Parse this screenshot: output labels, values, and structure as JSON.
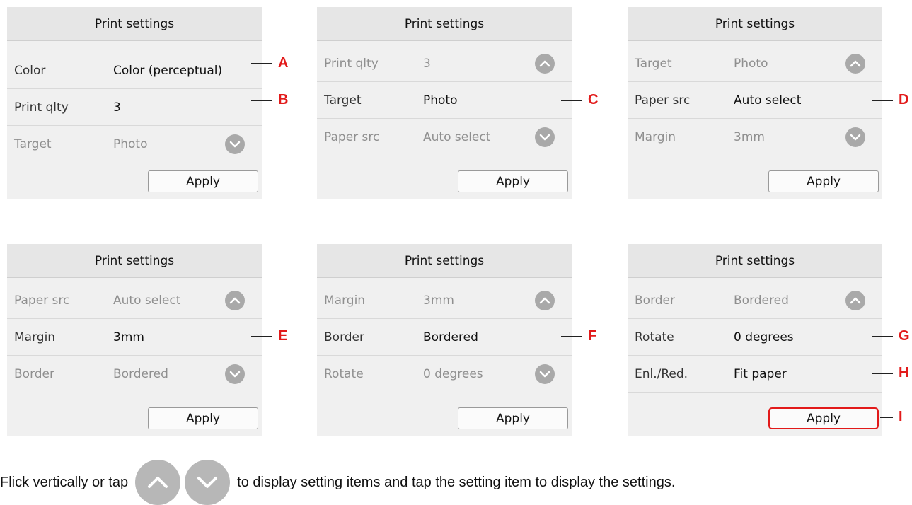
{
  "panels": [
    {
      "title": "Print settings",
      "rows": [
        {
          "label": "Color",
          "value": "Color (perceptual)"
        },
        {
          "label": "Print qlty",
          "value": "3"
        },
        {
          "label": "Target",
          "value": "Photo"
        }
      ],
      "apply_label": "Apply"
    },
    {
      "title": "Print settings",
      "rows": [
        {
          "label": "Print qlty",
          "value": "3"
        },
        {
          "label": "Target",
          "value": "Photo"
        },
        {
          "label": "Paper src",
          "value": "Auto select"
        }
      ],
      "apply_label": "Apply"
    },
    {
      "title": "Print settings",
      "rows": [
        {
          "label": "Target",
          "value": "Photo"
        },
        {
          "label": "Paper src",
          "value": "Auto select"
        },
        {
          "label": "Margin",
          "value": "3mm"
        }
      ],
      "apply_label": "Apply"
    },
    {
      "title": "Print settings",
      "rows": [
        {
          "label": "Paper src",
          "value": "Auto select"
        },
        {
          "label": "Margin",
          "value": "3mm"
        },
        {
          "label": "Border",
          "value": "Bordered"
        }
      ],
      "apply_label": "Apply"
    },
    {
      "title": "Print settings",
      "rows": [
        {
          "label": "Margin",
          "value": "3mm"
        },
        {
          "label": "Border",
          "value": "Bordered"
        },
        {
          "label": "Rotate",
          "value": "0 degrees"
        }
      ],
      "apply_label": "Apply"
    },
    {
      "title": "Print settings",
      "rows": [
        {
          "label": "Border",
          "value": "Bordered"
        },
        {
          "label": "Rotate",
          "value": "0 degrees"
        },
        {
          "label": "Enl./Red.",
          "value": "Fit paper"
        }
      ],
      "apply_label": "Apply"
    }
  ],
  "callouts": {
    "a": "A",
    "b": "B",
    "c": "C",
    "d": "D",
    "e": "E",
    "f": "F",
    "g": "G",
    "h": "H",
    "i": "I"
  },
  "footer": {
    "text_before": "Flick vertically or tap",
    "text_after": "to display setting items and tap the setting item to display the settings."
  },
  "colors": {
    "callout_red": "#e21a1a",
    "scroll_button_gray": "#a9a9a9",
    "panel_bg": "#f0f0f0"
  },
  "icons": [
    "chevron-up-icon",
    "chevron-down-icon"
  ]
}
